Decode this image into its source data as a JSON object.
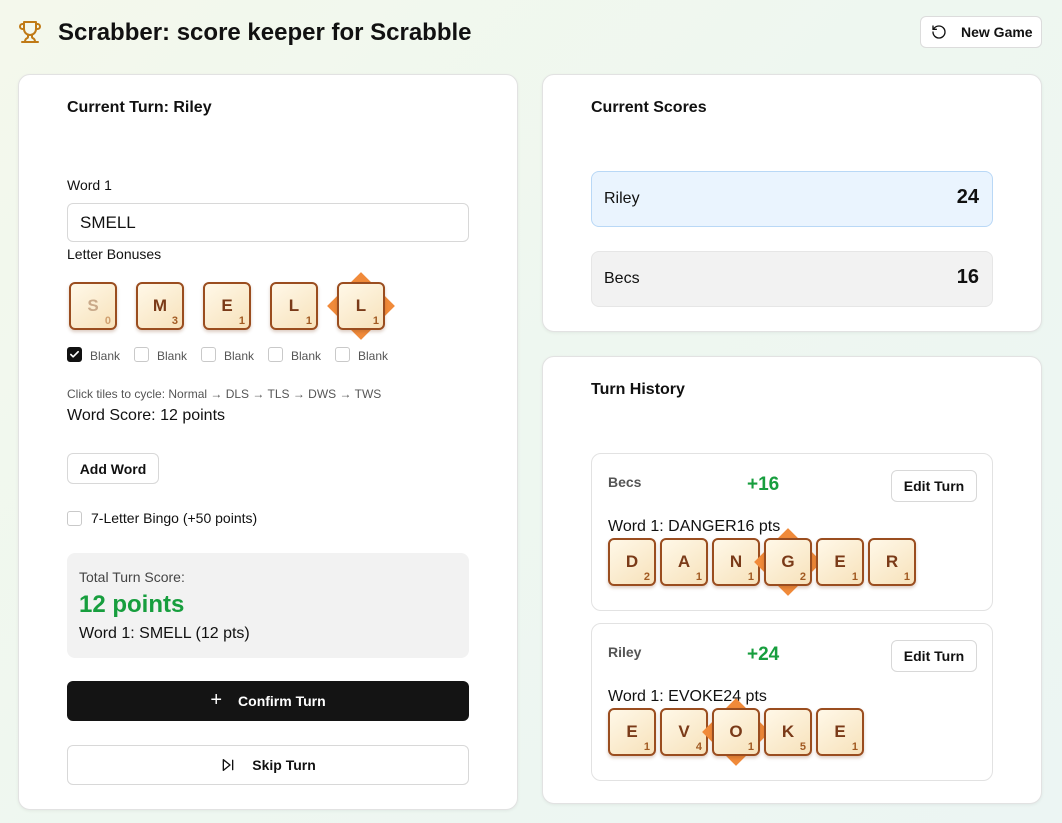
{
  "app": {
    "title": "Scrabber: score keeper for Scrabble",
    "new_game_label": "New Game"
  },
  "turn": {
    "title": "Current Turn: Riley",
    "word_label": "Word 1",
    "word_value": "SMELL",
    "bonuses_label": "Letter Bonuses",
    "tiles": [
      {
        "letter": "S",
        "value": "0",
        "blank": true,
        "bonus": "none"
      },
      {
        "letter": "M",
        "value": "3",
        "blank": false,
        "bonus": "none"
      },
      {
        "letter": "E",
        "value": "1",
        "blank": false,
        "bonus": "none"
      },
      {
        "letter": "L",
        "value": "1",
        "blank": false,
        "bonus": "none"
      },
      {
        "letter": "L",
        "value": "1",
        "blank": false,
        "bonus": "marked"
      }
    ],
    "blank_label": "Blank",
    "hint": "Click tiles to cycle: Normal → DLS → TLS → DWS → TWS",
    "word_score": "Word Score: 12 points",
    "add_word_label": "Add Word",
    "bingo_label": "7-Letter Bingo (+50 points)",
    "bingo_checked": false,
    "total_label": "Total Turn Score:",
    "total_points": "12 points",
    "total_detail": "Word 1: SMELL (12 pts)",
    "confirm_label": "Confirm Turn",
    "skip_label": "Skip Turn"
  },
  "scores": {
    "title": "Current Scores",
    "players": [
      {
        "name": "Riley",
        "score": "24",
        "active": true
      },
      {
        "name": "Becs",
        "score": "16",
        "active": false
      }
    ]
  },
  "history": {
    "title": "Turn History",
    "edit_label": "Edit Turn",
    "entries": [
      {
        "player": "Becs",
        "points": "+16",
        "word_line": "Word 1: DANGER16 pts",
        "tiles": [
          {
            "letter": "D",
            "value": "2",
            "bonus": "none"
          },
          {
            "letter": "A",
            "value": "1",
            "bonus": "none"
          },
          {
            "letter": "N",
            "value": "1",
            "bonus": "none"
          },
          {
            "letter": "G",
            "value": "2",
            "bonus": "marked"
          },
          {
            "letter": "E",
            "value": "1",
            "bonus": "none"
          },
          {
            "letter": "R",
            "value": "1",
            "bonus": "none"
          }
        ]
      },
      {
        "player": "Riley",
        "points": "+24",
        "word_line": "Word 1: EVOKE24 pts",
        "tiles": [
          {
            "letter": "E",
            "value": "1",
            "bonus": "none"
          },
          {
            "letter": "V",
            "value": "4",
            "bonus": "none"
          },
          {
            "letter": "O",
            "value": "1",
            "bonus": "marked"
          },
          {
            "letter": "K",
            "value": "5",
            "bonus": "none"
          },
          {
            "letter": "E",
            "value": "1",
            "bonus": "none"
          }
        ]
      }
    ]
  },
  "colors": {
    "tile_border": "#9a4d1f",
    "tile_face": "#f7e2bb",
    "bonus_marker": "#f08a3a",
    "score_green": "#179e3e",
    "primary_button": "#141414",
    "active_player": "#eaf4fe"
  },
  "icons": {
    "title": "trophy-icon",
    "new_game": "rotate-ccw-icon",
    "confirm": "plus-icon",
    "skip": "skip-forward-icon",
    "blank_checked": "check-icon"
  }
}
